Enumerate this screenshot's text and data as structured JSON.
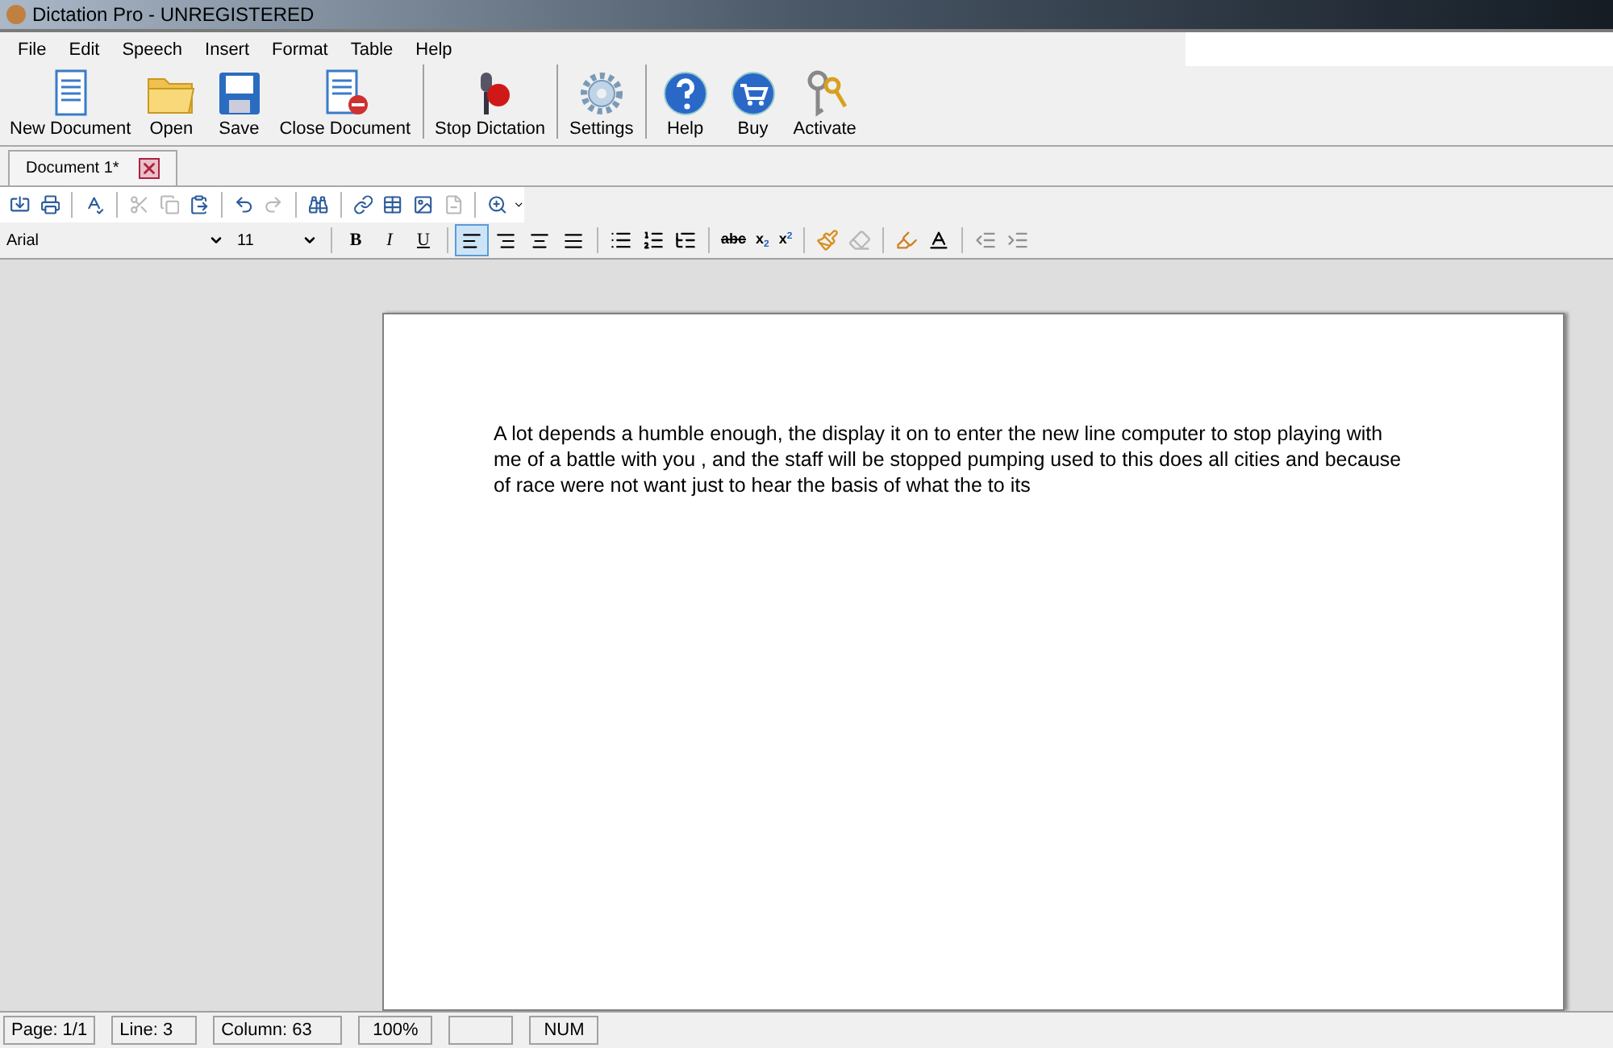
{
  "window": {
    "title": "Dictation Pro - UNREGISTERED"
  },
  "menu": [
    "File",
    "Edit",
    "Speech",
    "Insert",
    "Format",
    "Table",
    "Help"
  ],
  "toolbar": [
    {
      "label": "New Document",
      "kind": "new"
    },
    {
      "label": "Open",
      "kind": "open"
    },
    {
      "label": "Save",
      "kind": "save"
    },
    {
      "label": "Close Document",
      "kind": "close"
    },
    {
      "label": "Stop Dictation",
      "kind": "mic",
      "separator_before": true
    },
    {
      "label": "Settings",
      "kind": "settings",
      "separator_before": true
    },
    {
      "label": "Help",
      "kind": "help",
      "separator_before": true
    },
    {
      "label": "Buy",
      "kind": "buy"
    },
    {
      "label": "Activate",
      "kind": "activate"
    }
  ],
  "tabs": [
    {
      "label": "Document 1*",
      "selected": true
    }
  ],
  "edit_toolbar": [
    {
      "kind": "import",
      "disabled": false
    },
    {
      "kind": "print",
      "disabled": false
    },
    {
      "kind": "spell",
      "disabled": false
    },
    {
      "kind": "cut",
      "disabled": true
    },
    {
      "kind": "copy",
      "disabled": true
    },
    {
      "kind": "paste",
      "disabled": false
    },
    {
      "kind": "undo",
      "disabled": false
    },
    {
      "kind": "redo",
      "disabled": true
    },
    {
      "kind": "find",
      "disabled": false
    },
    {
      "kind": "link",
      "disabled": false
    },
    {
      "kind": "table",
      "disabled": false
    },
    {
      "kind": "image",
      "disabled": false
    },
    {
      "kind": "pagebreak",
      "disabled": true
    },
    {
      "kind": "zoom",
      "disabled": false
    }
  ],
  "format_bar": {
    "font": "Arial",
    "size": "11",
    "styles": [
      {
        "label": "B",
        "kind": "bold"
      },
      {
        "label": "I",
        "kind": "italic"
      },
      {
        "label": "U",
        "kind": "underline"
      }
    ],
    "alignment": [
      {
        "kind": "left",
        "selected": true
      },
      {
        "kind": "right",
        "selected": false
      },
      {
        "kind": "center",
        "selected": false
      },
      {
        "kind": "justify",
        "selected": false
      }
    ],
    "scripts": [
      {
        "label": "abc",
        "kind": "strike"
      },
      {
        "label": "x",
        "kind": "sub",
        "index": "2"
      },
      {
        "label": "x",
        "kind": "sup",
        "index": "2"
      }
    ]
  },
  "document": {
    "lines": [
      "A lot depends a humble enough, the display it on to enter the new line computer to stop playing with",
      "me of a battle with you , and the staff will be stopped pumping used to this does all cities and because",
      "of race were not want just to hear the basis of what the to its"
    ]
  },
  "status_bar": [
    "Page: 1/1",
    "Line: 3",
    "Column: 63",
    "100%",
    "NUM"
  ]
}
